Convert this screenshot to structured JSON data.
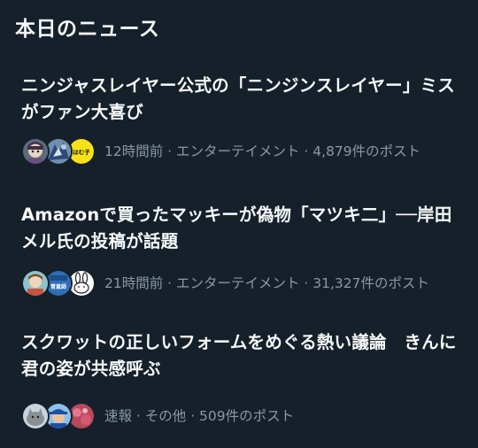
{
  "section": {
    "title": "本日のニュース"
  },
  "news": [
    {
      "headline": "ニンジャスレイヤー公式の「ニンジンスレイヤー」ミスがファン大喜び",
      "meta": "12時間前 · エンターテイメント · 4,879件のポスト",
      "avatars": [
        "anime-face-avatar",
        "mech-art-avatar",
        "yellow-text-avatar"
      ]
    },
    {
      "headline": "Amazonで買ったマッキーが偽物「マツキ二」──岸田メル氏の投稿が話題",
      "meta": "21時間前 · エンターテイメント · 31,327件のポスト",
      "avatars": [
        "illustration-avatar",
        "blue-badge-avatar",
        "rabbit-avatar"
      ]
    },
    {
      "headline": "スクワットの正しいフォームをめぐる熱い議論　きんに君の姿が共感呼ぶ",
      "meta": "速報 · その他 · 509件のポスト",
      "avatars": [
        "cat-photo-avatar",
        "cap-person-avatar",
        "floral-avatar"
      ]
    }
  ],
  "avatar_text": {
    "yellow": "はむ子",
    "badge": "青鼠師"
  },
  "colors": {
    "background": "#15202b",
    "text_primary": "#f7f9f9",
    "text_secondary": "#8b98a5"
  }
}
